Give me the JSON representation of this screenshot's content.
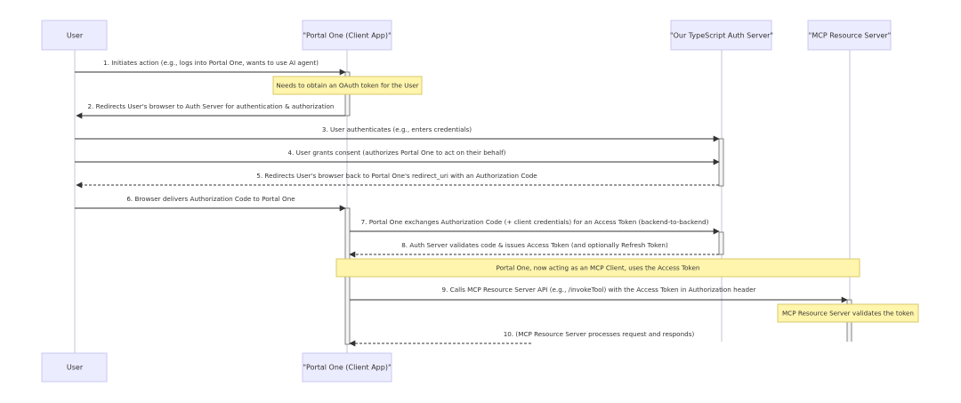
{
  "actors": [
    {
      "id": "user",
      "label": "User"
    },
    {
      "id": "portal",
      "label": "\"Portal One (Client App)\""
    },
    {
      "id": "auth",
      "label": "\"Our TypeScript Auth Server\""
    },
    {
      "id": "mcp",
      "label": "\"MCP Resource Server\""
    }
  ],
  "messages": [
    {
      "n": 1,
      "text": "1. Initiates action (e.g., logs into Portal One, wants to use AI agent)",
      "from": "user",
      "to": "portal",
      "dashed": false
    },
    {
      "n": 2,
      "text": "2. Redirects User's browser to Auth Server for authentication & authorization",
      "from": "portal",
      "to": "user",
      "dashed": false
    },
    {
      "n": 3,
      "text": "3. User authenticates (e.g., enters credentials)",
      "from": "user",
      "to": "auth",
      "dashed": false
    },
    {
      "n": 4,
      "text": "4. User grants consent (authorizes Portal One to act on their behalf)",
      "from": "user",
      "to": "auth",
      "dashed": false
    },
    {
      "n": 5,
      "text": "5. Redirects User's browser back to Portal One's redirect_uri with an Authorization Code",
      "from": "auth",
      "to": "user",
      "dashed": true
    },
    {
      "n": 6,
      "text": "6. Browser delivers Authorization Code to Portal One",
      "from": "user",
      "to": "portal",
      "dashed": false
    },
    {
      "n": 7,
      "text": "7. Portal One exchanges Authorization Code (+ client credentials) for an Access Token (backend-to-backend)",
      "from": "portal",
      "to": "auth",
      "dashed": false
    },
    {
      "n": 8,
      "text": "8. Auth Server validates code & issues Access Token (and optionally Refresh Token)",
      "from": "auth",
      "to": "portal",
      "dashed": true
    },
    {
      "n": 9,
      "text": "9. Calls MCP Resource Server API (e.g., /invokeTool) with the Access Token in Authorization header",
      "from": "portal",
      "to": "mcp",
      "dashed": false
    },
    {
      "n": 10,
      "text": "10. (MCP Resource Server processes request and responds)",
      "from": "mcp",
      "to": "portal",
      "dashed": true
    }
  ],
  "notes": [
    {
      "text": "Needs to obtain an OAuth token for the User"
    },
    {
      "text": "Portal One, now acting as an MCP Client, uses the Access Token"
    },
    {
      "text": "MCP Resource Server validates the token"
    }
  ],
  "colors": {
    "actor_fill": "#ececff",
    "note_fill": "#fff5ad",
    "line": "#333333"
  }
}
